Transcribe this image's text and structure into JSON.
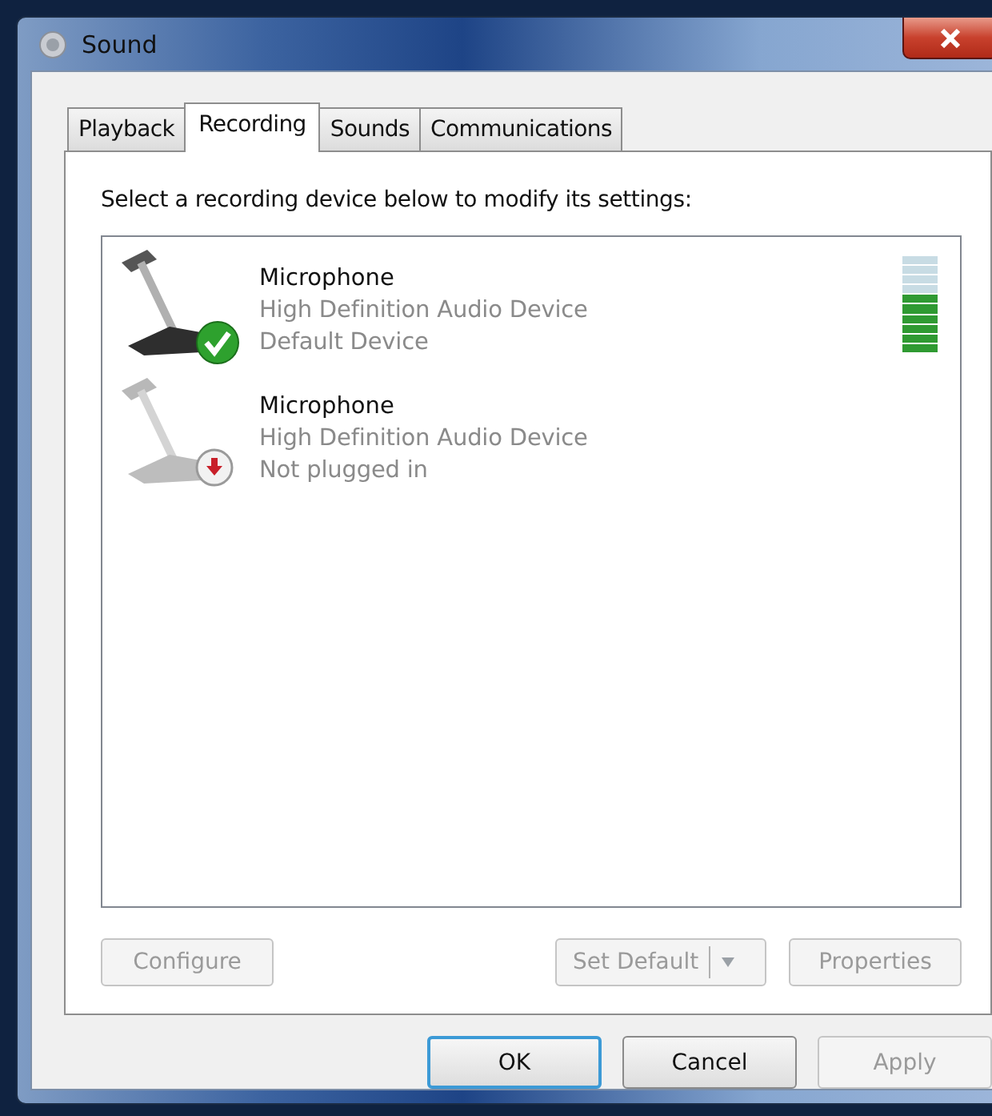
{
  "window": {
    "title": "Sound"
  },
  "tabs": [
    {
      "label": "Playback",
      "selected": false
    },
    {
      "label": "Recording",
      "selected": true
    },
    {
      "label": "Sounds",
      "selected": false
    },
    {
      "label": "Communications",
      "selected": false
    }
  ],
  "instruction": "Select a recording device below to modify its settings:",
  "devices": [
    {
      "kind": "default",
      "name": "Microphone",
      "driver": "High Definition Audio Device",
      "status": "Default Device",
      "level": 0.6
    },
    {
      "kind": "unplugged",
      "name": "Microphone",
      "driver": "High Definition Audio Device",
      "status": "Not plugged in"
    }
  ],
  "device_buttons": [
    {
      "label": "Configure",
      "disabled": true,
      "kind": "plain"
    },
    {
      "label": "Set Default",
      "disabled": true,
      "kind": "split"
    },
    {
      "label": "Properties",
      "disabled": true,
      "kind": "plain"
    }
  ],
  "dialog_buttons": [
    {
      "label": "OK",
      "disabled": false,
      "default": true
    },
    {
      "label": "Cancel",
      "disabled": false,
      "default": false
    },
    {
      "label": "Apply",
      "disabled": true,
      "default": false
    }
  ]
}
